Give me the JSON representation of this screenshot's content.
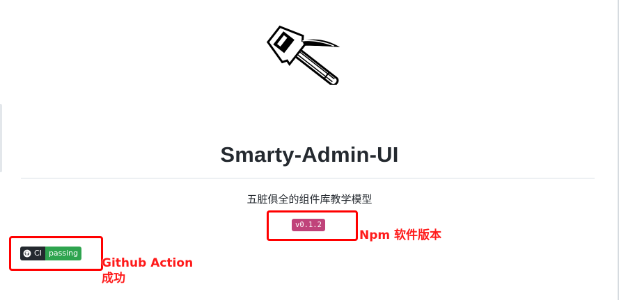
{
  "readme": {
    "logo_icon": "hammer-icon",
    "title": "Smarty-Admin-UI",
    "subtitle": "五脏俱全的组件库教学模型",
    "npm_badge": {
      "version": "v0.1.2",
      "color": "#c0437a"
    },
    "ci_badge": {
      "label": "CI",
      "status": "passing",
      "label_color": "#24292f",
      "status_color": "#2ea44f",
      "icon": "github-icon"
    }
  },
  "annotations": {
    "npm_note": "Npm 软件版本",
    "ci_note_line1": "Github Action",
    "ci_note_line2": "成功",
    "color": "#ff0000"
  }
}
